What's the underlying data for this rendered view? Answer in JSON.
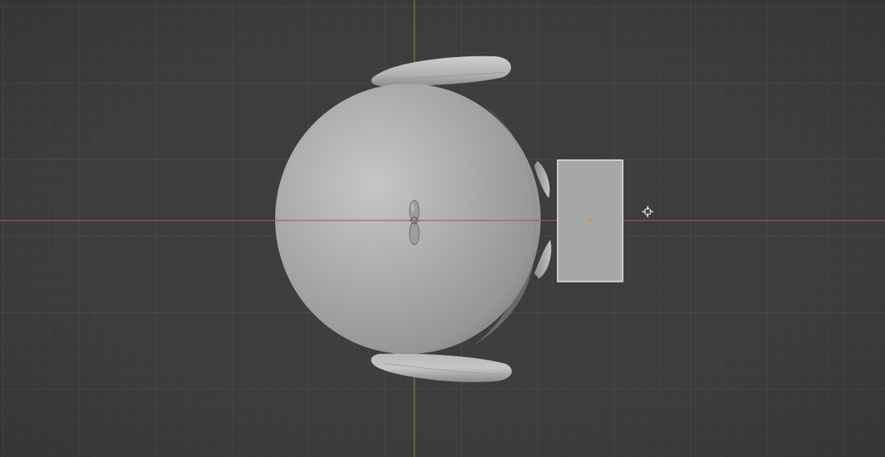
{
  "viewport": {
    "background_color": "#3d3d3d",
    "grid_color_minor": "#474747",
    "grid_color_major": "#4c4c4c",
    "x_axis_color": "#b0545a",
    "y_axis_color": "#6a8a2e",
    "mesh_color": "#a9a9a9",
    "selected_outline_color": "#ffffff",
    "origin_color": "#e0902a"
  },
  "scene": {
    "objects": [
      {
        "name": "head-sphere",
        "icon": "sphere-mesh"
      },
      {
        "name": "ear-top",
        "icon": "capsule-mesh"
      },
      {
        "name": "ear-bottom",
        "icon": "capsule-mesh"
      },
      {
        "name": "nose",
        "icon": "small-mesh"
      },
      {
        "name": "plane",
        "icon": "plane-mesh",
        "selected": true
      }
    ]
  },
  "cursor": {
    "icon": "3d-cursor-icon"
  }
}
